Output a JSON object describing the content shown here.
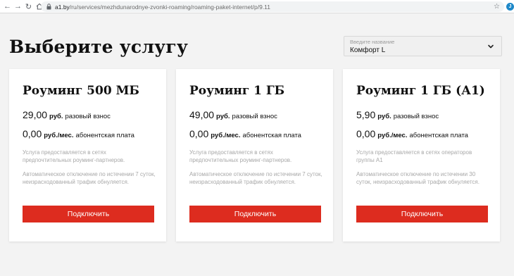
{
  "browser": {
    "url_host": "a1.by",
    "url_path": "/ru/services/mezhdunarodnye-zvonki-roaming/roaming-paket-internet/p/9.11",
    "profile_initial": "J"
  },
  "page": {
    "title": "Выберите услугу"
  },
  "selector": {
    "label": "Введите название",
    "value": "Комфорт L"
  },
  "cards": [
    {
      "title": "Роуминг 500 МБ",
      "one_time_amount": "29,00",
      "one_time_unit": "руб.",
      "one_time_label": "разовый взнос",
      "monthly_amount": "0,00",
      "monthly_unit": "руб./мес.",
      "monthly_label": "абонентская плата",
      "note_1": "Услуга предоставляется в сетях предпочтительных роуминг-партнеров.",
      "note_2": "Автоматическое отключение по истечении 7 суток, неизрасходованный трафик обнуляется.",
      "button_label": "Подключить"
    },
    {
      "title": "Роуминг 1 ГБ",
      "one_time_amount": "49,00",
      "one_time_unit": "руб.",
      "one_time_label": "разовый взнос",
      "monthly_amount": "0,00",
      "monthly_unit": "руб./мес.",
      "monthly_label": "абонентская плата",
      "note_1": "Услуга предоставляется в сетях предпочтительных роуминг-партнеров.",
      "note_2": "Автоматическое отключение по истечении 7 суток, неизрасходованный трафик обнуляется.",
      "button_label": "Подключить"
    },
    {
      "title": "Роуминг 1 ГБ (А1)",
      "one_time_amount": "5,90",
      "one_time_unit": "руб.",
      "one_time_label": "разовый взнос",
      "monthly_amount": "0,00",
      "monthly_unit": "руб./мес.",
      "monthly_label": "абонентская плата",
      "note_1": "Услуга предоставляется в сетях операторов группы А1",
      "note_2": "Автоматическое отключение по истечении 30 суток, неизрасходованный трафик обнуляется.",
      "button_label": "Подключить"
    }
  ],
  "colors": {
    "accent_red": "#dd2c1f",
    "page_background": "#f3f3f3",
    "card_background": "#ffffff",
    "muted_text": "#a8a8a8"
  },
  "icons": {
    "back": "back-arrow-icon",
    "forward": "forward-arrow-icon",
    "reload": "reload-icon",
    "home": "home-icon",
    "lock": "lock-icon",
    "star": "bookmark-star-icon",
    "dropdown": "chevron-down-icon"
  }
}
